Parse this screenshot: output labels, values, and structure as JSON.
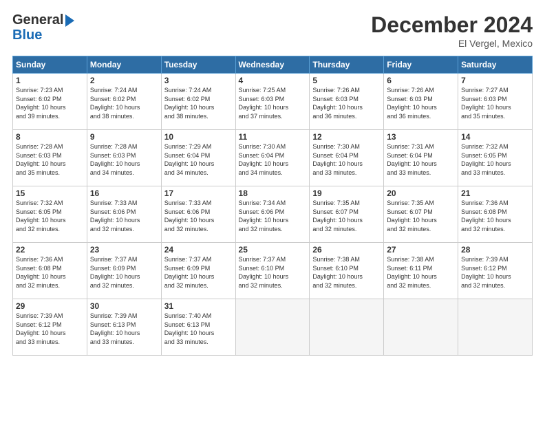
{
  "header": {
    "logo_line1": "General",
    "logo_line2": "Blue",
    "month_title": "December 2024",
    "location": "El Vergel, Mexico"
  },
  "days_of_week": [
    "Sunday",
    "Monday",
    "Tuesday",
    "Wednesday",
    "Thursday",
    "Friday",
    "Saturday"
  ],
  "weeks": [
    [
      {
        "day": "1",
        "info": "Sunrise: 7:23 AM\nSunset: 6:02 PM\nDaylight: 10 hours\nand 39 minutes."
      },
      {
        "day": "2",
        "info": "Sunrise: 7:24 AM\nSunset: 6:02 PM\nDaylight: 10 hours\nand 38 minutes."
      },
      {
        "day": "3",
        "info": "Sunrise: 7:24 AM\nSunset: 6:02 PM\nDaylight: 10 hours\nand 38 minutes."
      },
      {
        "day": "4",
        "info": "Sunrise: 7:25 AM\nSunset: 6:03 PM\nDaylight: 10 hours\nand 37 minutes."
      },
      {
        "day": "5",
        "info": "Sunrise: 7:26 AM\nSunset: 6:03 PM\nDaylight: 10 hours\nand 36 minutes."
      },
      {
        "day": "6",
        "info": "Sunrise: 7:26 AM\nSunset: 6:03 PM\nDaylight: 10 hours\nand 36 minutes."
      },
      {
        "day": "7",
        "info": "Sunrise: 7:27 AM\nSunset: 6:03 PM\nDaylight: 10 hours\nand 35 minutes."
      }
    ],
    [
      {
        "day": "8",
        "info": "Sunrise: 7:28 AM\nSunset: 6:03 PM\nDaylight: 10 hours\nand 35 minutes."
      },
      {
        "day": "9",
        "info": "Sunrise: 7:28 AM\nSunset: 6:03 PM\nDaylight: 10 hours\nand 34 minutes."
      },
      {
        "day": "10",
        "info": "Sunrise: 7:29 AM\nSunset: 6:04 PM\nDaylight: 10 hours\nand 34 minutes."
      },
      {
        "day": "11",
        "info": "Sunrise: 7:30 AM\nSunset: 6:04 PM\nDaylight: 10 hours\nand 34 minutes."
      },
      {
        "day": "12",
        "info": "Sunrise: 7:30 AM\nSunset: 6:04 PM\nDaylight: 10 hours\nand 33 minutes."
      },
      {
        "day": "13",
        "info": "Sunrise: 7:31 AM\nSunset: 6:04 PM\nDaylight: 10 hours\nand 33 minutes."
      },
      {
        "day": "14",
        "info": "Sunrise: 7:32 AM\nSunset: 6:05 PM\nDaylight: 10 hours\nand 33 minutes."
      }
    ],
    [
      {
        "day": "15",
        "info": "Sunrise: 7:32 AM\nSunset: 6:05 PM\nDaylight: 10 hours\nand 32 minutes."
      },
      {
        "day": "16",
        "info": "Sunrise: 7:33 AM\nSunset: 6:06 PM\nDaylight: 10 hours\nand 32 minutes."
      },
      {
        "day": "17",
        "info": "Sunrise: 7:33 AM\nSunset: 6:06 PM\nDaylight: 10 hours\nand 32 minutes."
      },
      {
        "day": "18",
        "info": "Sunrise: 7:34 AM\nSunset: 6:06 PM\nDaylight: 10 hours\nand 32 minutes."
      },
      {
        "day": "19",
        "info": "Sunrise: 7:35 AM\nSunset: 6:07 PM\nDaylight: 10 hours\nand 32 minutes."
      },
      {
        "day": "20",
        "info": "Sunrise: 7:35 AM\nSunset: 6:07 PM\nDaylight: 10 hours\nand 32 minutes."
      },
      {
        "day": "21",
        "info": "Sunrise: 7:36 AM\nSunset: 6:08 PM\nDaylight: 10 hours\nand 32 minutes."
      }
    ],
    [
      {
        "day": "22",
        "info": "Sunrise: 7:36 AM\nSunset: 6:08 PM\nDaylight: 10 hours\nand 32 minutes."
      },
      {
        "day": "23",
        "info": "Sunrise: 7:37 AM\nSunset: 6:09 PM\nDaylight: 10 hours\nand 32 minutes."
      },
      {
        "day": "24",
        "info": "Sunrise: 7:37 AM\nSunset: 6:09 PM\nDaylight: 10 hours\nand 32 minutes."
      },
      {
        "day": "25",
        "info": "Sunrise: 7:37 AM\nSunset: 6:10 PM\nDaylight: 10 hours\nand 32 minutes."
      },
      {
        "day": "26",
        "info": "Sunrise: 7:38 AM\nSunset: 6:10 PM\nDaylight: 10 hours\nand 32 minutes."
      },
      {
        "day": "27",
        "info": "Sunrise: 7:38 AM\nSunset: 6:11 PM\nDaylight: 10 hours\nand 32 minutes."
      },
      {
        "day": "28",
        "info": "Sunrise: 7:39 AM\nSunset: 6:12 PM\nDaylight: 10 hours\nand 32 minutes."
      }
    ],
    [
      {
        "day": "29",
        "info": "Sunrise: 7:39 AM\nSunset: 6:12 PM\nDaylight: 10 hours\nand 33 minutes."
      },
      {
        "day": "30",
        "info": "Sunrise: 7:39 AM\nSunset: 6:13 PM\nDaylight: 10 hours\nand 33 minutes."
      },
      {
        "day": "31",
        "info": "Sunrise: 7:40 AM\nSunset: 6:13 PM\nDaylight: 10 hours\nand 33 minutes."
      },
      {
        "day": "",
        "info": ""
      },
      {
        "day": "",
        "info": ""
      },
      {
        "day": "",
        "info": ""
      },
      {
        "day": "",
        "info": ""
      }
    ]
  ]
}
